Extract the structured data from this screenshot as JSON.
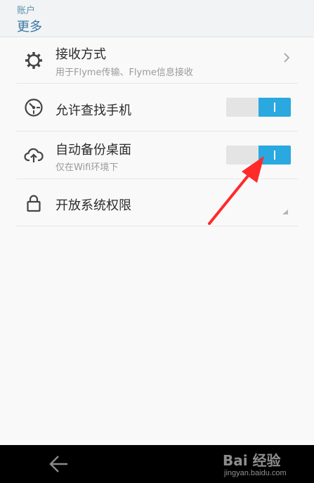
{
  "header": {
    "section": "账户",
    "title": "更多"
  },
  "rows": [
    {
      "title": "接收方式",
      "subtitle": "用于Flyme传输、Flyme信息接收",
      "icon": "gear-icon",
      "control": "chevron"
    },
    {
      "title": "允许查找手机",
      "icon": "locate-gauge-icon",
      "control": "toggle",
      "toggle_on": true
    },
    {
      "title": "自动备份桌面",
      "subtitle": "仅在Wifi环境下",
      "icon": "cloud-upload-icon",
      "control": "toggle",
      "toggle_on": true
    },
    {
      "title": "开放系统权限",
      "icon": "lock-icon",
      "control": "none"
    }
  ],
  "navbar": {
    "icon": "back-arrow-icon"
  },
  "watermark": {
    "brand": "Bai 经验",
    "url": "jingyan.baidu.com"
  },
  "colors": {
    "accent": "#2aa8e0",
    "annotation_arrow": "#ff2a2a",
    "header_text": "#3a77a3"
  }
}
